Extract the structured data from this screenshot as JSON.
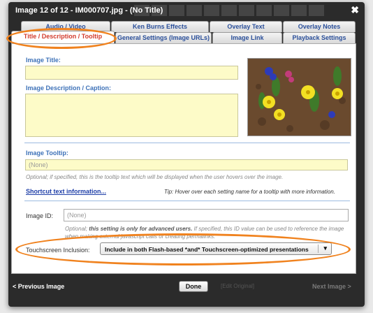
{
  "dialog": {
    "title": "Image 12 of 12 - IM000707.jpg - (No Title)",
    "close_glyph": "✖"
  },
  "tabs": {
    "row1": [
      "Audio / Video",
      "Ken Burns Effects",
      "Overlay Text",
      "Overlay Notes"
    ],
    "row2": [
      "Title / Description / Tooltip",
      "General Settings (Image URLs)",
      "Image Link",
      "Playback Settings"
    ],
    "active": "Title / Description / Tooltip"
  },
  "form": {
    "image_title_label": "Image Title:",
    "image_title_value": "",
    "description_label": "Image Description / Caption:",
    "description_value": "",
    "tooltip_label": "Image Tooltip:",
    "tooltip_value": "(None)",
    "tooltip_help": "Optional; if specified, this is the tooltip text which will be displayed when the user hovers over the image.",
    "shortcut_link": "Shortcut text information...",
    "tip_text": "Tip: Hover over each setting name for a tooltip with more information.",
    "image_id_label": "Image ID:",
    "image_id_value": "(None)",
    "image_id_help_prefix": "Optional;",
    "image_id_help_bold": "this setting is only for advanced users.",
    "image_id_help_rest": "If specified, this ID value can be used to reference the image when making external javascript calls or creating permalinks.",
    "touchscreen_label": "Touchscreen Inclusion:",
    "touchscreen_value": "Include in both Flash-based *and* Touchscreen-optimized presentations"
  },
  "footer": {
    "prev_label": "< Previous Image",
    "done_label": "Done",
    "edit_original_label": "[Edit Original]",
    "next_label": "Next Image >"
  },
  "colors": {
    "highlight_oval": "#f0821e",
    "field_bg": "#fdfbc8",
    "label_blue": "#3e72b8",
    "active_tab_text": "#d23b2c"
  },
  "icons": {
    "close": "close-icon",
    "dropdown": "chevron-down-icon"
  }
}
